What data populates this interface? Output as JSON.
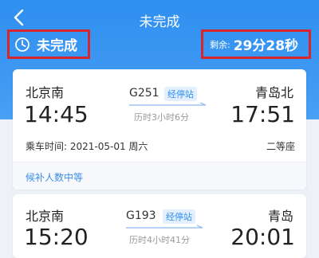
{
  "header": {
    "title": "未完成",
    "status_label": "未完成",
    "remaining_label": "剩余:",
    "countdown": "29分28秒"
  },
  "tickets": [
    {
      "from": "北京南",
      "depart": "14:45",
      "train": "G251",
      "badge": "经停站",
      "duration": "历时3小时6分",
      "to": "青岛北",
      "arrive": "17:51",
      "date_text": "乘车时间: 2021-05-01 周六",
      "seat": "二等座",
      "queue_text": "候补人数中等"
    },
    {
      "from": "北京南",
      "depart": "15:20",
      "train": "G193",
      "badge": "经停站",
      "duration": "历时4小时41分",
      "to": "青岛",
      "arrive": "20:01"
    }
  ],
  "colors": {
    "header": "#2f8ff0",
    "highlight_border": "#d6282c",
    "accent_text": "#3d8fe8"
  },
  "icons": {
    "back": "chevron-left-icon",
    "status": "clock-icon",
    "direction": "arrow-right-icon"
  }
}
